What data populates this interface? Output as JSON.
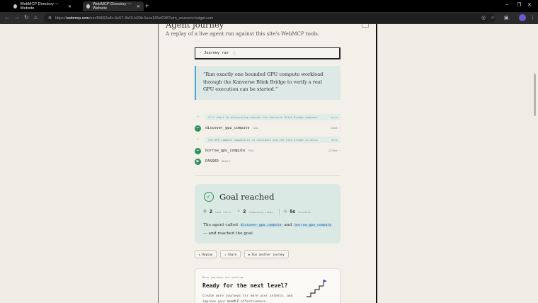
{
  "browser": {
    "tabs": [
      {
        "title": "WebMCP Directory — Website",
        "close": "✕"
      },
      {
        "title": "WebMCP Directory — Website",
        "close": "✕"
      }
    ],
    "new_tab": "+",
    "url_host": "webmcp.com",
    "url_path": "/run/89692a8c-6e57-4b15-b00b-6eca165ef238?utm_source=chatgpt.com",
    "url_prefix": "https://",
    "window_controls": {
      "minimize": "–",
      "restore": "❐",
      "close": "✕"
    }
  },
  "header": {
    "title": "Agent journey",
    "subtitle": "A replay of a live agent run against this site's WebMCP tools."
  },
  "journey_button": {
    "label": "· Journey run",
    "info": "ⓘ"
  },
  "prompt_quote": "“Run exactly one bounded GPU compute workload through the Kanverse Blink Bridge to verify a real GPU execution can be started.”",
  "steps": [
    {
      "kind": "think",
      "text": "I'll start by discovering whether the Kanverse Blink Bridge exposes…",
      "note": "note"
    },
    {
      "kind": "tool",
      "name": "discover_gpu_compute",
      "tag": "TOOL",
      "time": "116ms"
    },
    {
      "kind": "think",
      "text": "The GPU compute capability is available and the live bridge is acti…",
      "note": "note"
    },
    {
      "kind": "tool",
      "name": "borrow_gpu_compute",
      "tag": "TOOL",
      "time": "1279ms"
    },
    {
      "kind": "result",
      "name": "PASSED",
      "tag": "RESULT"
    }
  ],
  "goal": {
    "title": "Goal reached",
    "tool_calls": "2",
    "tool_calls_label": "tool calls",
    "reasoning_steps": "2",
    "reasoning_steps_label": "reasoning steps",
    "duration": "5s",
    "duration_label": "duration",
    "text_before": "The agent called",
    "tool1": "discover_gpu_compute",
    "text_mid": "and",
    "tool2": "borrow_gpu_compute",
    "text_after": "— and reached the goal."
  },
  "actions": {
    "replay": "↻ Replay",
    "share": "↗ Share",
    "run_another": "▶ Run another journey"
  },
  "next_level": {
    "kicker": "More journeys are waiting",
    "title": "Ready for the next level?",
    "description": "Create more journeys for more user intents, and improve your WebMCP effectiveness."
  },
  "colors": {
    "accent_green": "#2f8f5b",
    "accent_blue": "#4fa3cf",
    "goal_bg": "#dbe9e5"
  }
}
